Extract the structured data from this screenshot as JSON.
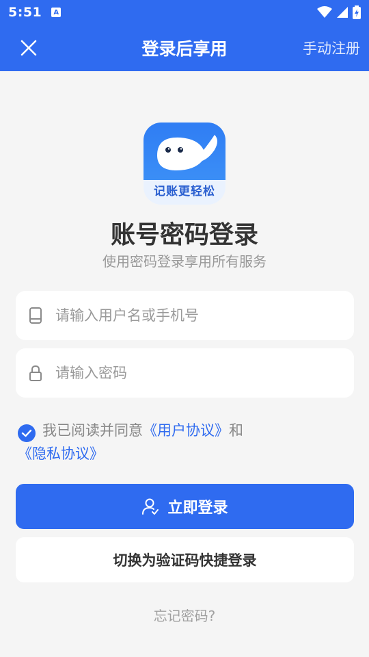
{
  "status_bar": {
    "time": "5:51",
    "app_icon_letter": "A"
  },
  "toolbar": {
    "title": "登录后享用",
    "register_label": "手动注册",
    "background_color": "#2f6bf0"
  },
  "logo": {
    "text": "记账更轻松"
  },
  "page": {
    "heading": "账号密码登录",
    "subheading": "使用密码登录享用所有服务"
  },
  "form": {
    "username_placeholder": "请输入用户名或手机号",
    "username_value": "",
    "password_placeholder": "请输入密码",
    "password_value": ""
  },
  "agreement": {
    "checked": true,
    "prefix": "我已阅读并同意",
    "user_agreement": "《用户协议》",
    "and": "和",
    "privacy_policy": "《隐私协议》"
  },
  "actions": {
    "login_label": "立即登录",
    "switch_label": "切换为验证码快捷登录",
    "forgot_label": "忘记密码?"
  },
  "icons": {
    "close": "close-icon",
    "phone": "phone-icon",
    "lock": "lock-icon",
    "user": "user-icon",
    "check": "check-icon"
  }
}
